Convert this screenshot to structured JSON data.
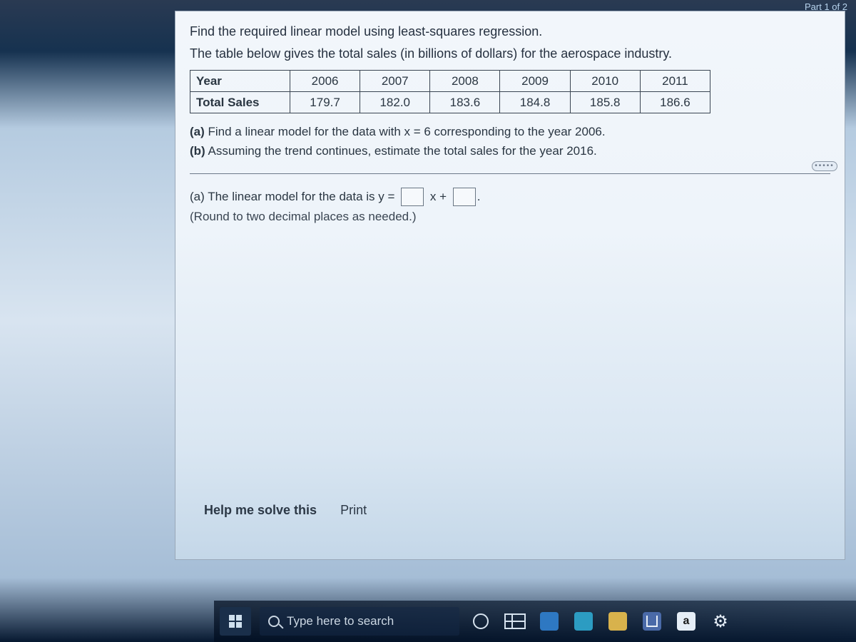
{
  "page_counter": "Part 1 of 2",
  "problem": {
    "intro1": "Find the required linear model using least-squares regression.",
    "intro2": "The table below gives the total sales (in billions of dollars) for the aerospace industry.",
    "table": {
      "row1_label": "Year",
      "row2_label": "Total Sales",
      "years": [
        "2006",
        "2007",
        "2008",
        "2009",
        "2010",
        "2011"
      ],
      "sales": [
        "179.7",
        "182.0",
        "183.6",
        "184.8",
        "185.8",
        "186.6"
      ]
    },
    "part_a_label": "(a)",
    "part_a_text": "Find a linear model for the data with x = 6 corresponding to the year 2006.",
    "part_b_label": "(b)",
    "part_b_text": "Assuming the trend continues, estimate the total sales for the year 2016."
  },
  "answer": {
    "prefix": "(a) The linear model for the data is y =",
    "mid": "x +",
    "suffix": ".",
    "hint": "(Round to two decimal places as needed.)"
  },
  "links": {
    "help": "Help me solve this",
    "print": "Print"
  },
  "taskbar": {
    "search_placeholder": "Type here to search",
    "amazon_label": "a"
  },
  "chart_data": {
    "type": "table",
    "title": "Total sales (billions of dollars) for the aerospace industry",
    "categories": [
      "2006",
      "2007",
      "2008",
      "2009",
      "2010",
      "2011"
    ],
    "values": [
      179.7,
      182.0,
      183.6,
      184.8,
      185.8,
      186.6
    ],
    "xlabel": "Year",
    "ylabel": "Total Sales (billions $)"
  }
}
